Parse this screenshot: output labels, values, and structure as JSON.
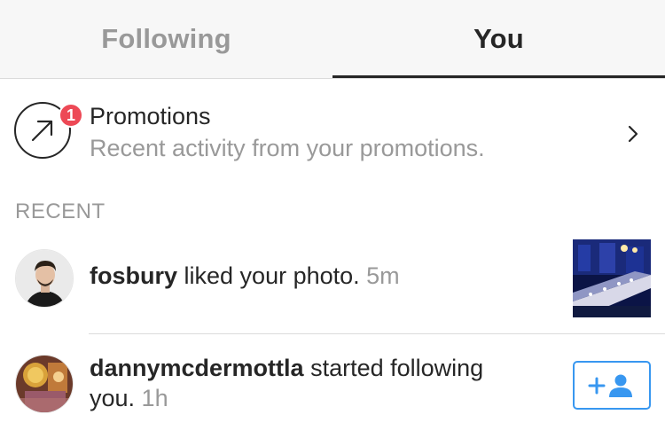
{
  "tabs": [
    {
      "label": "Following",
      "active": false
    },
    {
      "label": "You",
      "active": true
    }
  ],
  "promotions": {
    "title": "Promotions",
    "subtitle": "Recent activity from your promotions.",
    "badge_count": "1",
    "icon": "arrow-up-right-icon"
  },
  "section_label": "RECENT",
  "activity": [
    {
      "username": "fosbury",
      "action": " liked your photo.",
      "time": " 5m",
      "avatar": "avatar-photo",
      "right": "photo-thumbnail"
    },
    {
      "username": "dannymcdermottla",
      "action": " started following",
      "action2": "you.",
      "time": " 1h",
      "avatar": "avatar-photo",
      "right": "follow-button"
    }
  ],
  "colors": {
    "accent": "#3897f0",
    "badge": "#ed4956",
    "muted": "#999999",
    "text": "#262626"
  }
}
